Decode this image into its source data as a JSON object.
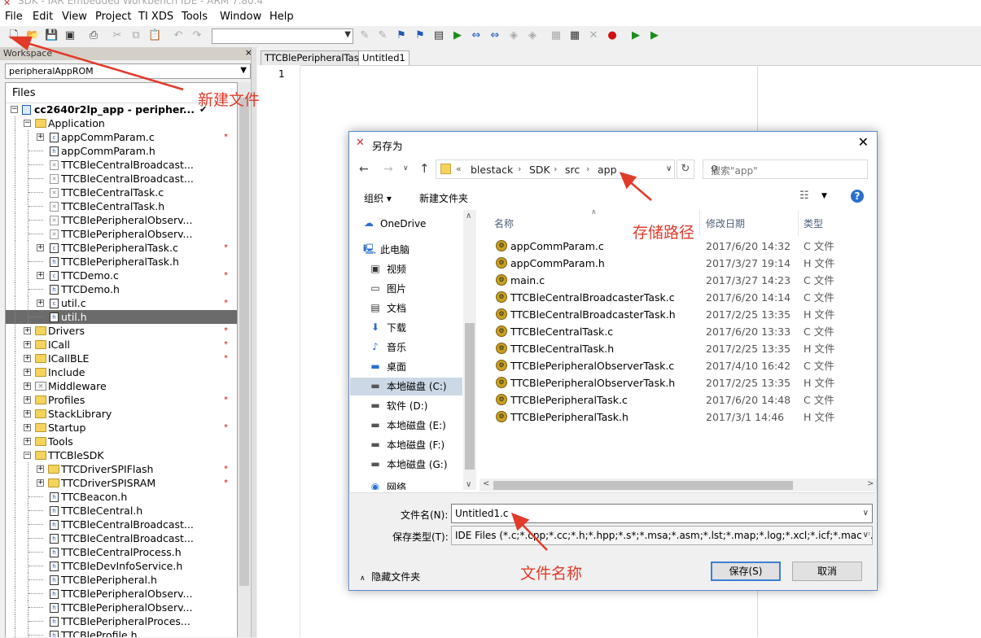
{
  "window": {
    "title": "SDK - IAR Embedded Workbench IDE - ARM 7.80.4"
  },
  "menu": [
    "File",
    "Edit",
    "View",
    "Project",
    "TI XDS",
    "Tools",
    "Window",
    "Help"
  ],
  "workspace": {
    "title": "Workspace",
    "close": "×",
    "config": "peripheralAppROM",
    "files_header": "Files",
    "project": "cc2640r2lp_app - peripher...",
    "project_check": "✔",
    "tree": [
      {
        "label": "Application",
        "icon": "folder-icon",
        "level": 1,
        "expand": "-",
        "mark": ""
      },
      {
        "label": "appCommParam.c",
        "icon": "c-file-icon",
        "level": 2,
        "expand": "+",
        "mark": "*"
      },
      {
        "label": "appCommParam.h",
        "icon": "h-file-icon",
        "level": 2,
        "expand": "",
        "mark": ""
      },
      {
        "label": "TTCBleCentralBroadcast...",
        "icon": "excluded-file-icon",
        "level": 2,
        "expand": "",
        "mark": ""
      },
      {
        "label": "TTCBleCentralBroadcast...",
        "icon": "excluded-file-icon",
        "level": 2,
        "expand": "",
        "mark": ""
      },
      {
        "label": "TTCBleCentralTask.c",
        "icon": "excluded-file-icon",
        "level": 2,
        "expand": "",
        "mark": ""
      },
      {
        "label": "TTCBleCentralTask.h",
        "icon": "excluded-file-icon",
        "level": 2,
        "expand": "",
        "mark": ""
      },
      {
        "label": "TTCBlePeripheralObserv...",
        "icon": "excluded-file-icon",
        "level": 2,
        "expand": "",
        "mark": ""
      },
      {
        "label": "TTCBlePeripheralObserv...",
        "icon": "excluded-file-icon",
        "level": 2,
        "expand": "",
        "mark": ""
      },
      {
        "label": "TTCBlePeripheralTask.c",
        "icon": "c-file-icon",
        "level": 2,
        "expand": "+",
        "mark": "*"
      },
      {
        "label": "TTCBlePeripheralTask.h",
        "icon": "h-file-icon",
        "level": 2,
        "expand": "",
        "mark": ""
      },
      {
        "label": "TTCDemo.c",
        "icon": "c-file-icon",
        "level": 2,
        "expand": "+",
        "mark": "*"
      },
      {
        "label": "TTCDemo.h",
        "icon": "h-file-icon",
        "level": 2,
        "expand": "",
        "mark": ""
      },
      {
        "label": "util.c",
        "icon": "c-file-icon",
        "level": 2,
        "expand": "+",
        "mark": "*"
      },
      {
        "label": "util.h",
        "icon": "h-file-icon",
        "level": 2,
        "expand": "",
        "mark": "",
        "selected": true
      },
      {
        "label": "Drivers",
        "icon": "folder-icon",
        "level": 1,
        "expand": "+",
        "mark": "*"
      },
      {
        "label": "ICall",
        "icon": "folder-icon",
        "level": 1,
        "expand": "+",
        "mark": "*"
      },
      {
        "label": "ICallBLE",
        "icon": "folder-icon",
        "level": 1,
        "expand": "+",
        "mark": "*"
      },
      {
        "label": "Include",
        "icon": "folder-icon",
        "level": 1,
        "expand": "+",
        "mark": ""
      },
      {
        "label": "Middleware",
        "icon": "excluded-folder-icon",
        "level": 1,
        "expand": "+",
        "mark": ""
      },
      {
        "label": "Profiles",
        "icon": "folder-icon",
        "level": 1,
        "expand": "+",
        "mark": "*"
      },
      {
        "label": "StackLibrary",
        "icon": "folder-icon",
        "level": 1,
        "expand": "+",
        "mark": ""
      },
      {
        "label": "Startup",
        "icon": "folder-icon",
        "level": 1,
        "expand": "+",
        "mark": "*"
      },
      {
        "label": "Tools",
        "icon": "folder-icon",
        "level": 1,
        "expand": "+",
        "mark": ""
      },
      {
        "label": "TTCBleSDK",
        "icon": "folder-icon",
        "level": 1,
        "expand": "-",
        "mark": ""
      },
      {
        "label": "TTCDriverSPIFlash",
        "icon": "folder-icon",
        "level": 2,
        "expand": "+",
        "mark": "*"
      },
      {
        "label": "TTCDriverSPISRAM",
        "icon": "folder-icon",
        "level": 2,
        "expand": "+",
        "mark": "*"
      },
      {
        "label": "TTCBeacon.h",
        "icon": "h-file-icon",
        "level": 2,
        "expand": "",
        "mark": ""
      },
      {
        "label": "TTCBleCentral.h",
        "icon": "h-file-icon",
        "level": 2,
        "expand": "",
        "mark": ""
      },
      {
        "label": "TTCBleCentralBroadcast...",
        "icon": "h-file-icon",
        "level": 2,
        "expand": "",
        "mark": ""
      },
      {
        "label": "TTCBleCentralBroadcast...",
        "icon": "h-file-icon",
        "level": 2,
        "expand": "",
        "mark": ""
      },
      {
        "label": "TTCBleCentralProcess.h",
        "icon": "h-file-icon",
        "level": 2,
        "expand": "",
        "mark": ""
      },
      {
        "label": "TTCBleDevInfoService.h",
        "icon": "h-file-icon",
        "level": 2,
        "expand": "",
        "mark": ""
      },
      {
        "label": "TTCBlePeripheral.h",
        "icon": "h-file-icon",
        "level": 2,
        "expand": "",
        "mark": ""
      },
      {
        "label": "TTCBlePeripheralObserv...",
        "icon": "h-file-icon",
        "level": 2,
        "expand": "",
        "mark": ""
      },
      {
        "label": "TTCBlePeripheralObserv...",
        "icon": "h-file-icon",
        "level": 2,
        "expand": "",
        "mark": ""
      },
      {
        "label": "TTCBlePeripheralProces...",
        "icon": "h-file-icon",
        "level": 2,
        "expand": "",
        "mark": ""
      },
      {
        "label": "TTCBleProfile.h",
        "icon": "h-file-icon",
        "level": 2,
        "expand": "",
        "mark": ""
      }
    ]
  },
  "editor": {
    "tabs": [
      "TTCBlePeripheralTask.c",
      "Untitled1"
    ],
    "active_tab": 1,
    "line_number": "1"
  },
  "dialog": {
    "title": "另存为",
    "close": "✕",
    "breadcrumb": [
      "«",
      "blestack",
      "SDK",
      "src",
      "app"
    ],
    "search_placeholder": "搜索\"app\"",
    "organize": "组织 ▾",
    "new_folder": "新建文件夹",
    "nav": [
      {
        "label": "OneDrive",
        "icon": "cloud-icon",
        "color": "#2b6fd1",
        "glyph": "☁"
      },
      {
        "label": "此电脑",
        "icon": "computer-icon",
        "color": "#2b6fd1",
        "glyph": "🖳"
      },
      {
        "label": "视频",
        "icon": "video-icon",
        "color": "#333",
        "glyph": "▣"
      },
      {
        "label": "图片",
        "icon": "pictures-icon",
        "color": "#333",
        "glyph": "▭"
      },
      {
        "label": "文档",
        "icon": "documents-icon",
        "color": "#333",
        "glyph": "▤"
      },
      {
        "label": "下载",
        "icon": "download-icon",
        "color": "#2b6fd1",
        "glyph": "⬇"
      },
      {
        "label": "音乐",
        "icon": "music-icon",
        "color": "#2b6fd1",
        "glyph": "♪"
      },
      {
        "label": "桌面",
        "icon": "desktop-icon",
        "color": "#2b6fd1",
        "glyph": "▬"
      },
      {
        "label": "本地磁盘 (C:)",
        "icon": "drive-c-icon",
        "color": "#555",
        "glyph": "▬",
        "selected": true
      },
      {
        "label": "软件 (D:)",
        "icon": "drive-icon",
        "color": "#555",
        "glyph": "▬"
      },
      {
        "label": "本地磁盘 (E:)",
        "icon": "drive-icon",
        "color": "#555",
        "glyph": "▬"
      },
      {
        "label": "本地磁盘 (F:)",
        "icon": "drive-icon",
        "color": "#555",
        "glyph": "▬"
      },
      {
        "label": "本地磁盘 (G:)",
        "icon": "drive-icon",
        "color": "#555",
        "glyph": "▬"
      },
      {
        "label": "网络",
        "icon": "network-icon",
        "color": "#2b6fd1",
        "glyph": "◉"
      }
    ],
    "columns": {
      "name": "名称",
      "date": "修改日期",
      "type": "类型"
    },
    "files": [
      {
        "name": "appCommParam.c",
        "date": "2017/6/20 14:32",
        "type": "C 文件"
      },
      {
        "name": "appCommParam.h",
        "date": "2017/3/27 19:14",
        "type": "H 文件"
      },
      {
        "name": "main.c",
        "date": "2017/3/27 14:23",
        "type": "C 文件"
      },
      {
        "name": "TTCBleCentralBroadcasterTask.c",
        "date": "2017/6/20 14:14",
        "type": "C 文件"
      },
      {
        "name": "TTCBleCentralBroadcasterTask.h",
        "date": "2017/2/25 13:35",
        "type": "H 文件"
      },
      {
        "name": "TTCBleCentralTask.c",
        "date": "2017/6/20 13:33",
        "type": "C 文件"
      },
      {
        "name": "TTCBleCentralTask.h",
        "date": "2017/2/25 13:35",
        "type": "H 文件"
      },
      {
        "name": "TTCBlePeripheralObserverTask.c",
        "date": "2017/4/10 16:42",
        "type": "C 文件"
      },
      {
        "name": "TTCBlePeripheralObserverTask.h",
        "date": "2017/2/25 13:35",
        "type": "H 文件"
      },
      {
        "name": "TTCBlePeripheralTask.c",
        "date": "2017/6/20 14:48",
        "type": "C 文件"
      },
      {
        "name": "TTCBlePeripheralTask.h",
        "date": "2017/3/1 14:46",
        "type": "H 文件"
      }
    ],
    "filename_label": "文件名(N):",
    "filename_value": "Untitled1.c",
    "filetype_label": "保存类型(T):",
    "filetype_value": "IDE Files (*.c;*.cpp;*.cc;*.h;*.hpp;*.s*;*.msa;*.asm;*.lst;*.map;*.log;*.xcl;*.icf;*.mac;*.prj;*.p",
    "hide_folders": "隐藏文件夹",
    "save": "保存(S)",
    "cancel": "取消"
  },
  "annotations": {
    "new_file": "新建文件",
    "save_path": "存储路径",
    "file_name": "文件名称",
    "color": "#e23b2a"
  }
}
